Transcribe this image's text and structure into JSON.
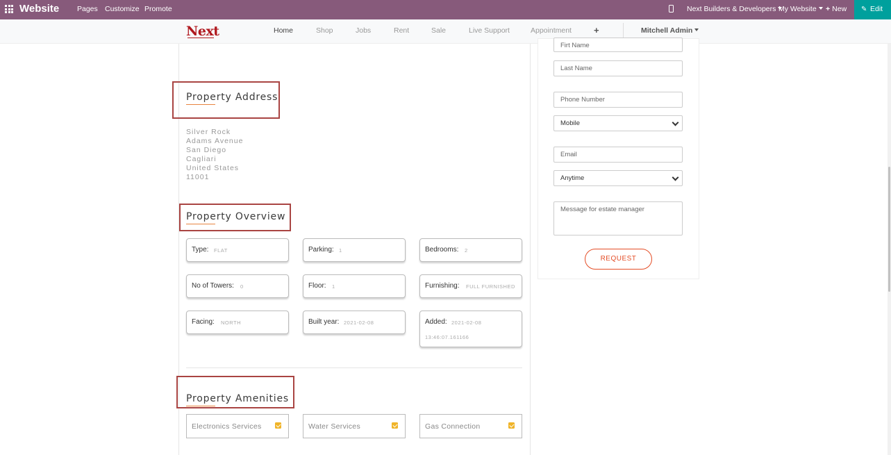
{
  "topbar": {
    "brand": "Website",
    "menu": [
      "Pages",
      "Customize",
      "Promote"
    ],
    "company": "Next Builders & Developers",
    "my_website": "My Website",
    "new_label": "New",
    "edit_label": "Edit",
    "bg_color": "#875a7b",
    "edit_color": "#00a09d"
  },
  "navbar": {
    "logo": "Next",
    "links": [
      "Home",
      "Shop",
      "Jobs",
      "Rent",
      "Sale",
      "Live Support",
      "Appointment"
    ],
    "plus": "+",
    "user": "Mitchell Admin"
  },
  "address": {
    "heading": "Property Address",
    "lines": [
      "Silver Rock",
      "Adams Avenue",
      "San Diego",
      "Cagliari",
      "United States",
      "11001"
    ]
  },
  "overview": {
    "heading": "Property Overview",
    "cards": [
      {
        "label": "Type:",
        "value": "FLAT"
      },
      {
        "label": "Parking:",
        "value": "1"
      },
      {
        "label": "Bedrooms:",
        "value": "2"
      },
      {
        "label": "No of Towers:",
        "value": "0"
      },
      {
        "label": "Floor:",
        "value": "1"
      },
      {
        "label": "Furnishing:",
        "value": "FULL FURNISHED"
      },
      {
        "label": "Facing:",
        "value": "NORTH"
      },
      {
        "label": "Built year:",
        "value": "2021-02-08"
      },
      {
        "label": "Added:",
        "value": "2021-02-08",
        "value2": "13:46:07.161166"
      }
    ]
  },
  "amenities": {
    "heading": "Property Amenities",
    "items": [
      "Electronics Services",
      "Water Services",
      "Gas Connection"
    ]
  },
  "form": {
    "first_name": "Firt Name",
    "last_name": "Last Name",
    "phone": "Phone Number",
    "phone_type": "Mobile",
    "email": "Email",
    "time": "Anytime",
    "message": "Message for estate manager",
    "request": "REQUEST",
    "accent": "#e44d26"
  },
  "highlight_color": "#a94442"
}
